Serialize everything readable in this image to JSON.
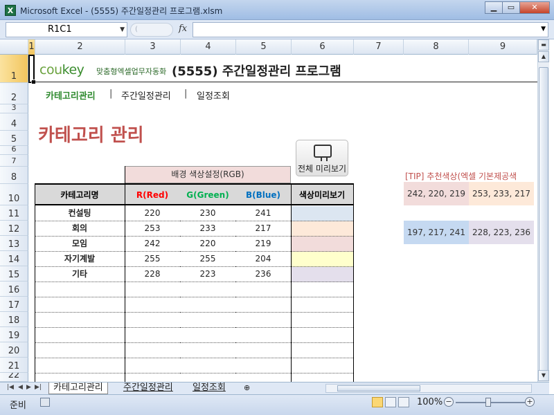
{
  "window": {
    "title": "Microsoft Excel - (5555) 주간일정관리 프로그램.xlsm",
    "app_icon": "X",
    "minimize": "▁",
    "maximize": "▭",
    "close": "✕"
  },
  "formula_bar": {
    "name_box": "R1C1",
    "fx": "fx",
    "formula": ""
  },
  "columns": [
    "1",
    "2",
    "3",
    "4",
    "5",
    "6",
    "7",
    "8",
    "9"
  ],
  "rows": [
    "1",
    "2",
    "3",
    "4",
    "5",
    "6",
    "7",
    "8",
    "10",
    "11",
    "12",
    "13",
    "14",
    "15",
    "16",
    "17",
    "18",
    "19",
    "20",
    "21",
    "22"
  ],
  "header": {
    "logo_main": "cou",
    "logo_key": "key",
    "logo_sub": "맞춤형엑셀업무자동화",
    "title": "(5555) 주간일정관리 프로그램"
  },
  "nav": {
    "items": [
      "카테고리관리",
      "주간일정관리",
      "일정조회"
    ],
    "separator": "|"
  },
  "section_title": "카테고리 관리",
  "preview_button": {
    "label": "전체 미리보기"
  },
  "table": {
    "bg_header": "배경 색상설정(RGB)",
    "col_name": "카테고리명",
    "col_r": "R(Red)",
    "col_g": "G(Green)",
    "col_b": "B(Blue)",
    "col_preview": "색상미리보기",
    "col_colors": {
      "r": "#ff0000",
      "g": "#00b050",
      "b": "#0070c0"
    },
    "rows": [
      {
        "name": "컨설팅",
        "r": "220",
        "g": "230",
        "b": "241",
        "color": "#dce6f1"
      },
      {
        "name": "회의",
        "r": "253",
        "g": "233",
        "b": "217",
        "color": "#fde9d9"
      },
      {
        "name": "모임",
        "r": "242",
        "g": "220",
        "b": "219",
        "color": "#f2dcdb"
      },
      {
        "name": "자기계발",
        "r": "255",
        "g": "255",
        "b": "204",
        "color": "#ffffcc"
      },
      {
        "name": "기타",
        "r": "228",
        "g": "223",
        "b": "236",
        "color": "#e4dfec"
      }
    ]
  },
  "tip": {
    "label": "[TIP] 추천색상(엑셀 기본제공색",
    "swatches": [
      {
        "text": "242, 220, 219",
        "color": "#f2dcdb"
      },
      {
        "text": "253, 233, 217",
        "color": "#fde9d9"
      },
      {
        "text": "197, 217, 241",
        "color": "#c5d9f1"
      },
      {
        "text": "228, 223, 236",
        "color": "#e4dfec"
      }
    ]
  },
  "tabs": {
    "items": [
      "카테고리관리",
      "주간일정관리",
      "일정조회"
    ],
    "nav_first": "|◀",
    "nav_prev": "◀",
    "nav_next": "▶",
    "nav_last": "▶|",
    "new_sheet": "⊕"
  },
  "status": {
    "ready": "준비",
    "zoom": "100%",
    "zoom_minus": "−",
    "zoom_plus": "+",
    "zoom_level": 100
  }
}
